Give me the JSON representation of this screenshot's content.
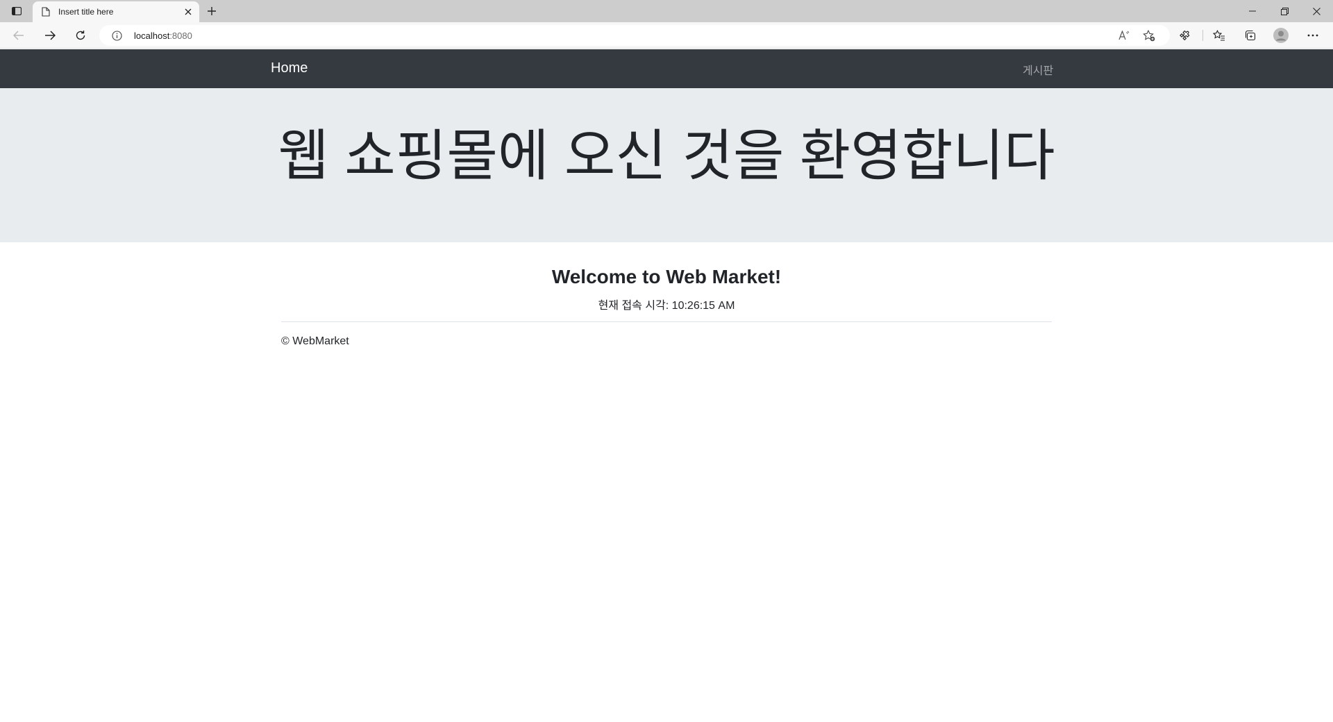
{
  "browser": {
    "tab": {
      "title": "Insert title here"
    },
    "address": {
      "host": "localhost",
      "port": ":8080"
    },
    "icons": {
      "sidebar_toggle": "tab-actions-icon",
      "favicon": "page-icon",
      "tab_close": "close-icon",
      "new_tab": "plus-icon",
      "back": "arrow-left-icon",
      "forward": "arrow-right-icon",
      "refresh": "refresh-icon",
      "info": "info-icon",
      "read_aloud": "read-aloud-icon",
      "favorite_add": "star-add-icon",
      "extensions": "puzzle-icon",
      "favorites": "favorites-icon",
      "collections": "collections-icon",
      "profile": "avatar-icon",
      "more": "more-icon"
    }
  },
  "navbar": {
    "brand": "Home",
    "board_link": "게시판",
    "bg_color": "#343a40"
  },
  "jumbotron": {
    "title": "웹 쇼핑몰에 오신 것을 환영합니다",
    "bg_color": "#e9ecef"
  },
  "main": {
    "welcome": "Welcome to Web Market!",
    "access_time": "현재 접속 시각: 10:26:15 AM"
  },
  "footer": {
    "text": "© WebMarket"
  }
}
